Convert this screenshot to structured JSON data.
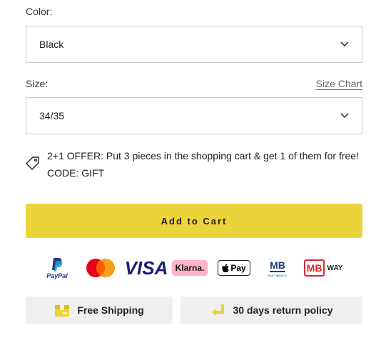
{
  "color": {
    "label": "Color:",
    "selected": "Black"
  },
  "size": {
    "label": "Size:",
    "selected": "34/35",
    "size_chart_link": "Size Chart"
  },
  "offer": {
    "line1": "2+1 OFFER: Put 3 pieces in the shopping cart & get 1 of them for free!",
    "line2": "CODE: GIFT"
  },
  "add_to_cart_label": "Add to Cart",
  "payment_methods": {
    "paypal": "PayPal",
    "visa": "VISA",
    "klarna": "Klarna.",
    "applepay": "Pay",
    "multibanco": "MB",
    "multibanco_sub": "MULTIBANCO",
    "mbway_mb": "MB",
    "mbway_way": "WAY"
  },
  "perks": {
    "shipping": "Free Shipping",
    "returns": "30 days return policy"
  },
  "colors": {
    "accent": "#ebd43a",
    "perk_bg": "#efefef",
    "visa_blue": "#1a1f71",
    "klarna_pink": "#ffb3c7",
    "paypal_dark": "#253b80",
    "paypal_light": "#179bd7",
    "mb_blue": "#1b3e7a",
    "mbway_red": "#d9272e",
    "icon_yellow": "#ebd43a"
  }
}
